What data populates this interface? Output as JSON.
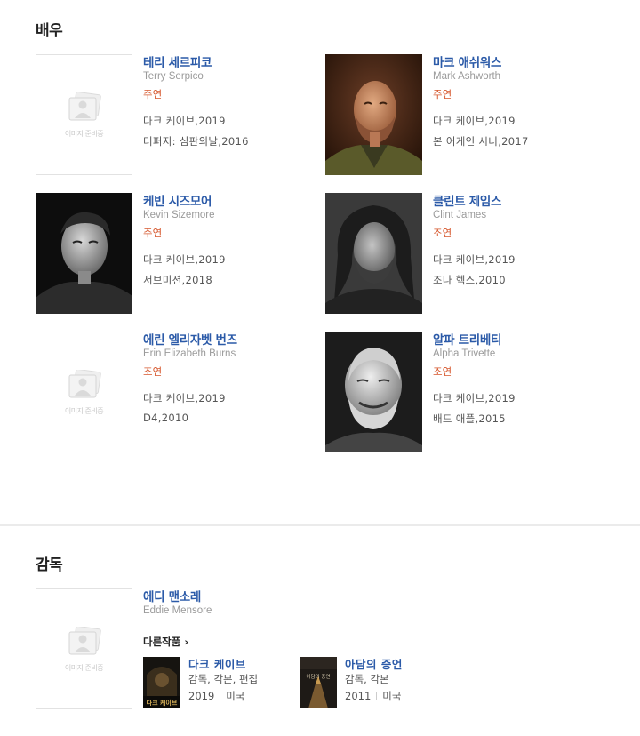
{
  "actors": {
    "title": "배우",
    "placeholder_text": "이미지 준비중",
    "cast": [
      {
        "name_ko": "테리 세르피코",
        "name_en": "Terry Serpico",
        "role": "주연",
        "works": [
          "다크 케이브,2019",
          "더퍼지: 심판의날,2016"
        ]
      },
      {
        "name_ko": "마크 애쉬워스",
        "name_en": "Mark Ashworth",
        "role": "주연",
        "works": [
          "다크 케이브,2019",
          "본 어게인 시너,2017"
        ]
      },
      {
        "name_ko": "케빈 시즈모어",
        "name_en": "Kevin Sizemore",
        "role": "주연",
        "works": [
          "다크 케이브,2019",
          "서브미션,2018"
        ]
      },
      {
        "name_ko": "클린트 제임스",
        "name_en": "Clint James",
        "role": "조연",
        "works": [
          "다크 케이브,2019",
          "조나 헥스,2010"
        ]
      },
      {
        "name_ko": "에린 엘리자벳 번즈",
        "name_en": "Erin Elizabeth Burns",
        "role": "조연",
        "works": [
          "다크 케이브,2019",
          "D4,2010"
        ]
      },
      {
        "name_ko": "알파 트리베티",
        "name_en": "Alpha Trivette",
        "role": "조연",
        "works": [
          "다크 케이브,2019",
          "배드 애플,2015"
        ]
      }
    ]
  },
  "director": {
    "title": "감독",
    "placeholder_text": "이미지 준비중",
    "name_ko": "에디 맨소레",
    "name_en": "Eddie Mensore",
    "other_works_label": "다른작품 ›",
    "films": [
      {
        "title": "다크 케이브",
        "roles": "감독, 각본, 편집",
        "year": "2019",
        "country": "미국",
        "poster_text": "다크 케이브"
      },
      {
        "title": "아담의 증언",
        "roles": "감독, 각본",
        "year": "2011",
        "country": "미국",
        "poster_text": "아담의 증언"
      }
    ]
  }
}
